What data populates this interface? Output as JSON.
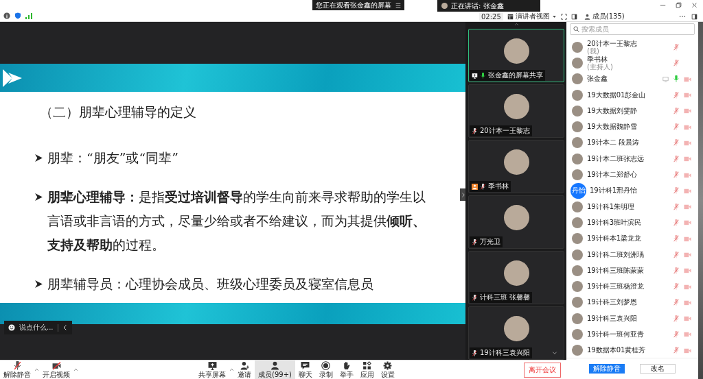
{
  "top_banners": {
    "viewing": "您正在观看张金鑫的屏幕",
    "speaking": "正在讲话: 张金鑫"
  },
  "meeting_bar": {
    "timer": "02:25",
    "view_button": "演讲者视图",
    "members_button": "成员(135)"
  },
  "slide": {
    "title": "（二）朋辈心理辅导的定义",
    "bullets": [
      "朋辈：“朋友”或“同辈”",
      "**朋辈心理辅导：**是指**受过培训督导**的学生向前来寻求帮助的学生以言语或非言语的方式，尽量少给或者不给建议，而为其提供**倾听、支持及帮助**的过程。",
      "朋辈辅导员：心理协会成员、班级心理委员及寝室信息员"
    ]
  },
  "chat_input": {
    "placeholder": "说点什么..."
  },
  "video_tiles": [
    {
      "name": "张金鑫的屏幕共享",
      "kind": "sharing",
      "selected": true
    },
    {
      "name": "20计本一王黎志",
      "kind": "muted",
      "selected": false
    },
    {
      "name": "季书林",
      "kind": "host",
      "selected": false
    },
    {
      "name": "万光卫",
      "kind": "muted",
      "selected": false
    },
    {
      "name": "计科三班 张馨馨",
      "kind": "muted",
      "selected": false
    },
    {
      "name": "19计科三袁兴阳",
      "kind": "muted",
      "selected": false
    }
  ],
  "toolbar": [
    {
      "label": "解除静音",
      "kind": "mic",
      "selected": false
    },
    {
      "label": "开启视频",
      "kind": "video",
      "selected": false
    },
    {
      "label": "共享屏幕",
      "kind": "share",
      "selected": false
    },
    {
      "label": "邀请",
      "kind": "invite",
      "selected": false
    },
    {
      "label": "成员(99+)",
      "kind": "members",
      "selected": true
    },
    {
      "label": "聊天",
      "kind": "chat",
      "selected": false
    },
    {
      "label": "录制",
      "kind": "record",
      "selected": false
    },
    {
      "label": "举手",
      "kind": "hand",
      "selected": false
    },
    {
      "label": "应用",
      "kind": "apps",
      "selected": false
    },
    {
      "label": "设置",
      "kind": "settings",
      "selected": false
    }
  ],
  "leave_button": "离开会议",
  "participants_panel": {
    "search_placeholder": "搜索成员",
    "participants": [
      {
        "name": "20计本一王黎志",
        "note": "(我)",
        "muted": true,
        "camera": false,
        "screen": false
      },
      {
        "name": "季书林",
        "note": "(主持人)",
        "muted": true,
        "camera": false,
        "screen": false
      },
      {
        "name": "张金鑫",
        "muted": false,
        "camera": true,
        "screen": true
      },
      {
        "name": "19大数据01彭金山",
        "muted": true,
        "camera": true,
        "screen": false
      },
      {
        "name": "19大数据刘雯静",
        "muted": true,
        "camera": true,
        "screen": false
      },
      {
        "name": "19大数据魏静雪",
        "muted": true,
        "camera": true,
        "screen": false
      },
      {
        "name": "19计本二 段晨涛",
        "muted": true,
        "camera": true,
        "screen": false
      },
      {
        "name": "19计本二班张志远",
        "muted": true,
        "camera": true,
        "screen": false
      },
      {
        "name": "19计本二郑舒心",
        "muted": true,
        "camera": true,
        "screen": false
      },
      {
        "name": "19计科1邢丹怡",
        "avatar_text": "丹怡",
        "muted": true,
        "camera": true,
        "screen": false
      },
      {
        "name": "19计科1朱明理",
        "muted": true,
        "camera": true,
        "screen": false
      },
      {
        "name": "19计科3班叶滨民",
        "muted": true,
        "camera": true,
        "screen": false
      },
      {
        "name": "19计科本1梁龙龙",
        "muted": true,
        "camera": true,
        "screen": false
      },
      {
        "name": "19计科二班刘洲瑀",
        "muted": true,
        "camera": true,
        "screen": false
      },
      {
        "name": "19计科三班陈蒙蒙",
        "muted": true,
        "camera": true,
        "screen": false
      },
      {
        "name": "19计科三班杨澄龙",
        "muted": true,
        "camera": true,
        "screen": false
      },
      {
        "name": "19计科三刘梦恩",
        "muted": true,
        "camera": true,
        "screen": false
      },
      {
        "name": "19计科三袁兴阳",
        "muted": true,
        "camera": true,
        "screen": false
      },
      {
        "name": "19计科一班何亚青",
        "muted": true,
        "camera": true,
        "screen": false
      },
      {
        "name": "19数据本01黄桂芳",
        "muted": true,
        "camera": true,
        "screen": false
      }
    ],
    "buttons": [
      "解除静音",
      "改名"
    ]
  }
}
